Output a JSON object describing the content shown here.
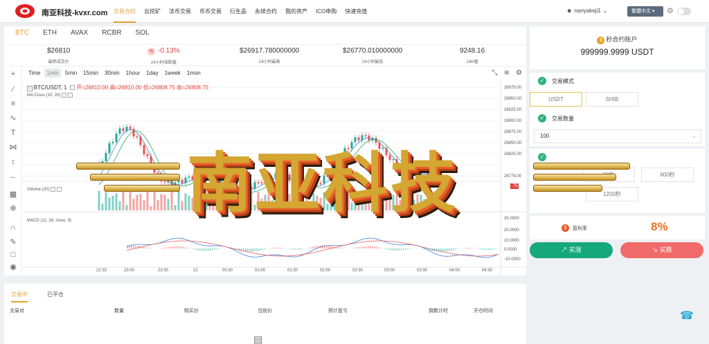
{
  "site": {
    "name": "南亚科技-kvxr.com"
  },
  "nav": {
    "items": [
      "交易合约",
      "云挖矿",
      "法币交易",
      "币币交易",
      "衍生品",
      "永续合约",
      "我的资产",
      "ICO申购",
      "快速充值"
    ]
  },
  "user": {
    "name": "nanyakeji1",
    "lang": "繁體中文"
  },
  "coins": [
    "BTC",
    "ETH",
    "AVAX",
    "RCBR",
    "SOL"
  ],
  "stats": [
    {
      "value": "$26810",
      "label": "最新成交价"
    },
    {
      "value": "-0.13%",
      "label": "24小时涨跌幅"
    },
    {
      "value": "$26917.780000000",
      "label": "24小时最高"
    },
    {
      "value": "$26770.010000000",
      "label": "24小时最低"
    },
    {
      "value": "9248.16",
      "label": "24H量"
    }
  ],
  "timeframes": [
    "Time",
    "1min",
    "5min",
    "15min",
    "30min",
    "1hour",
    "1day",
    "1week",
    "1mon"
  ],
  "legend": {
    "pair": "BTC/USDT, 1",
    "ohlc": "开=26810.00  高=26810.00  低=26808.75  收=26808.75",
    "ma": "MA Cross (10, 20)",
    "volume": "Volume (20)",
    "macd": "MACD (12, 26, close, 9)"
  },
  "price_axis": [
    "26975.00",
    "26950.00",
    "26925.00",
    "26900.00",
    "26875.00",
    "26850.00",
    "26825.00",
    "26775.00"
  ],
  "macd_axis": [
    "30.0000",
    "20.0000",
    "10.0000",
    "0.0000",
    "-10.0000"
  ],
  "price_tag": ".75",
  "time_axis": [
    "22:33",
    "23:00",
    "23:30",
    "12",
    "00:30",
    "01:00",
    "01:30",
    "02:00",
    "02:30",
    "03:00",
    "03:30",
    "04:00",
    "04:30"
  ],
  "orders": {
    "tabs": [
      "交易中",
      "已平仓"
    ],
    "headers": [
      "交易对",
      "数量",
      "购买价",
      "当前价",
      "预计盈亏",
      "倒数计时",
      "开仓时间"
    ]
  },
  "account": {
    "title": "秒合约账户",
    "balance": "999999.9999 USDT"
  },
  "trade_mode": {
    "title": "交易模式",
    "options": [
      "USDT",
      "SHIB"
    ]
  },
  "trade_qty": {
    "title": "交易数量",
    "value": "100"
  },
  "durations": [
    "00秒",
    "600秒",
    "1200秒"
  ],
  "yield": {
    "label": "盈利率",
    "value": "8%"
  },
  "actions": {
    "buy": "买涨",
    "sell": "买跌"
  },
  "watermark": "南亚科技"
}
